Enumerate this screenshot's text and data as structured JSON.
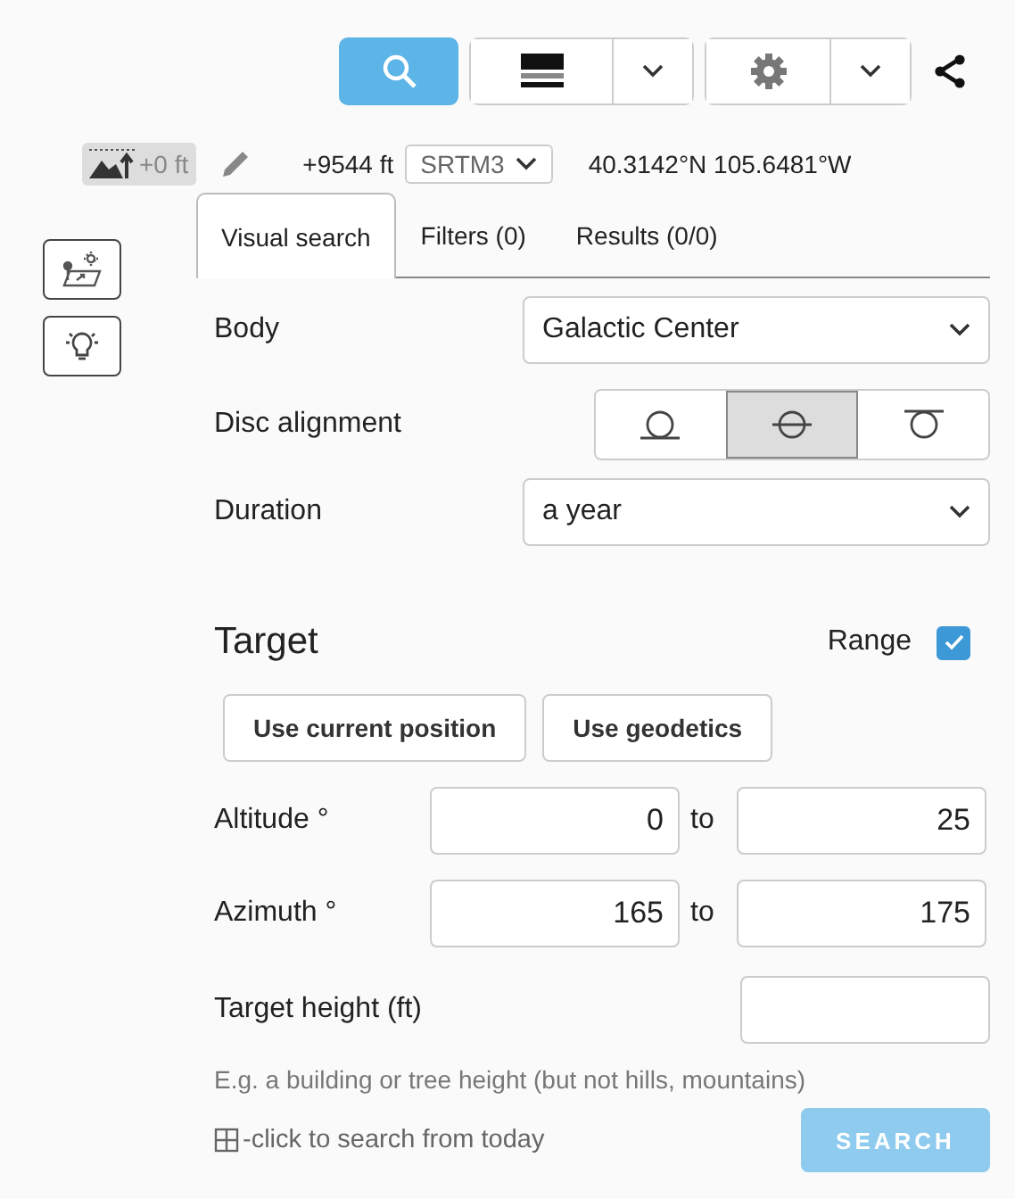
{
  "toolbar": [
    {
      "kind": "search",
      "selected": true
    },
    {
      "kind": "layers",
      "selected": false
    },
    {
      "kind": "settings",
      "selected": false
    },
    {
      "kind": "share",
      "selected": false
    }
  ],
  "info": {
    "offset": "+0 ft",
    "elevation": "+9544 ft",
    "dem": "SRTM3",
    "coords": "40.3142°N 105.6481°W"
  },
  "tabs": [
    {
      "label": "Visual search",
      "selected": true
    },
    {
      "label": "Filters (0)",
      "selected": false
    },
    {
      "label": "Results (0/0)",
      "selected": false
    }
  ],
  "body": {
    "label": "Body",
    "value": "Galactic Center"
  },
  "disc_alignment": {
    "label": "Disc alignment",
    "options": [
      {
        "kind": "bottom",
        "selected": false
      },
      {
        "kind": "center",
        "selected": true
      },
      {
        "kind": "top",
        "selected": false
      }
    ]
  },
  "duration": {
    "label": "Duration",
    "value": "a year"
  },
  "target": {
    "title": "Target",
    "range": {
      "label": "Range",
      "checked": true
    },
    "buttons": [
      "Use current position",
      "Use geodetics"
    ],
    "ranges": [
      {
        "label": "Altitude °",
        "from": "0",
        "to_label": "to",
        "to": "25"
      },
      {
        "label": "Azimuth °",
        "from": "165",
        "to_label": "to",
        "to": "175"
      }
    ],
    "height": {
      "label": "Target height (ft)"
    },
    "hint": "E.g. a building or tree height (but not hills, mountains)",
    "shortcut": "-click to search from today",
    "search": {
      "label": "SEARCH",
      "disabled": true
    }
  }
}
